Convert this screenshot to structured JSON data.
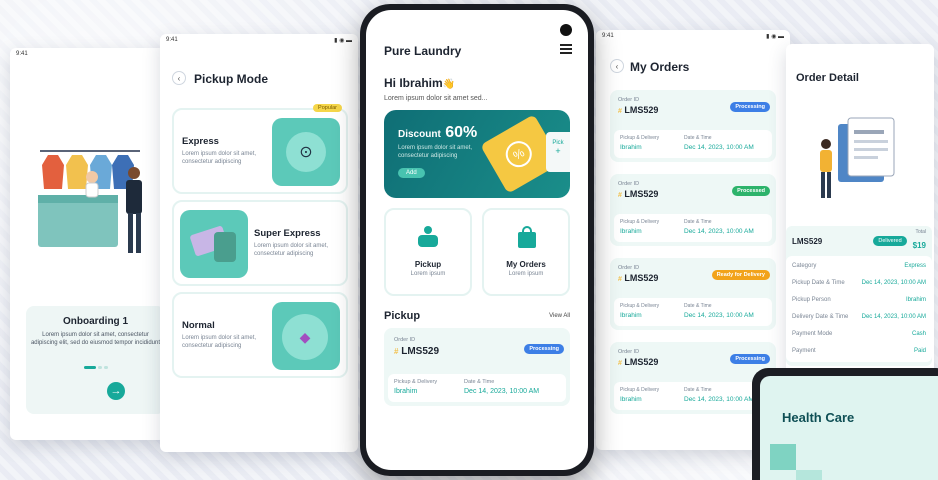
{
  "status_time": "9:41",
  "onboarding": {
    "title": "Onboarding 1",
    "text": "Lorem ipsum dolor sit amet, consectetur adipiscing elit, sed do eiusmod tempor incididunt"
  },
  "pickup_mode": {
    "title": "Pickup Mode",
    "popular": "Popular",
    "options": [
      {
        "name": "Express",
        "desc": "Lorem ipsum dolor sit amet, consectetur adipiscing"
      },
      {
        "name": "Super Express",
        "desc": "Lorem ipsum dolor sit amet, consectetur adipiscing"
      },
      {
        "name": "Normal",
        "desc": "Lorem ipsum dolor sit amet, consectetur adipiscing"
      }
    ]
  },
  "home": {
    "app_title": "Pure Laundry",
    "greeting": "Hi Ibrahim",
    "wave": "👋",
    "sub": "Lorem ipsum dolor sit amet sed...",
    "discount_label": "Discount",
    "discount_value": "60%",
    "discount_text": "Lorem ipsum dolor sit amet, consectetur adipiscing",
    "add": "Add",
    "pick_tag": "Pick",
    "tiles": [
      {
        "title": "Pickup",
        "sub": "Lorem ipsum"
      },
      {
        "title": "My Orders",
        "sub": "Lorem ipsum"
      }
    ],
    "section": "Pickup",
    "view_all": "View All",
    "order": {
      "id_label": "Order ID",
      "id": "LMS529",
      "status": "Processing",
      "pd_label": "Pickup & Delivery",
      "pd": "Ibrahim",
      "dt_label": "Date & Time",
      "dt": "Dec 14, 2023, 10:00 AM"
    }
  },
  "my_orders": {
    "title": "My Orders",
    "orders": [
      {
        "id_label": "Order ID",
        "id": "LMS529",
        "status": "Processing",
        "pd_label": "Pickup & Delivery",
        "pd": "Ibrahim",
        "dt_label": "Date & Time",
        "dt": "Dec 14, 2023, 10:00 AM"
      },
      {
        "id_label": "Order ID",
        "id": "LMS529",
        "status": "Processed",
        "pd_label": "Pickup & Delivery",
        "pd": "Ibrahim",
        "dt_label": "Date & Time",
        "dt": "Dec 14, 2023, 10:00 AM"
      },
      {
        "id_label": "Order ID",
        "id": "LMS529",
        "status": "Ready for Delivery",
        "pd_label": "Pickup & Delivery",
        "pd": "Ibrahim",
        "dt_label": "Date & Time",
        "dt": "Dec 14, 2023, 10:00 AM"
      },
      {
        "id_label": "Order ID",
        "id": "LMS529",
        "status": "Processing",
        "pd_label": "Pickup & Delivery",
        "pd": "Ibrahim",
        "dt_label": "Date & Time",
        "dt": "Dec 14, 2023, 10:00 AM"
      }
    ]
  },
  "order_detail": {
    "title": "Order Detail",
    "id": "LMS529",
    "status": "Delivered",
    "total_label": "Total",
    "total": "$19",
    "rows": [
      {
        "k": "Category",
        "v": "Express"
      },
      {
        "k": "Pickup Date & Time",
        "v": "Dec 14, 2023, 10:00 AM"
      },
      {
        "k": "Pickup Person",
        "v": "Ibrahim"
      },
      {
        "k": "Delivery Date & Time",
        "v": "Dec 14, 2023, 10:00 AM"
      },
      {
        "k": "Payment Mode",
        "v": "Cash"
      },
      {
        "k": "Payment",
        "v": "Paid"
      }
    ]
  },
  "health": {
    "title": "Health Care"
  },
  "colors": {
    "teal": "#17a99a",
    "dark_teal": "#0f6e75",
    "yellow": "#f5c842",
    "blue": "#3d7fe6",
    "green": "#2db36b",
    "orange": "#f2a31b"
  }
}
